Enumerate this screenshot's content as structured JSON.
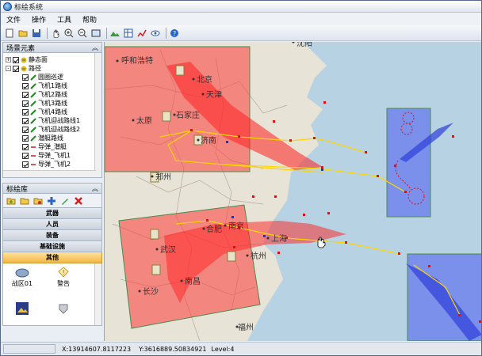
{
  "window": {
    "title": "标绘系统"
  },
  "menu": [
    "文件",
    "操作",
    "工具",
    "帮助"
  ],
  "toolbar_icons": [
    "new-file-icon",
    "open-folder-icon",
    "save-icon",
    "pan-icon",
    "zoom-in-icon",
    "zoom-out-icon",
    "full-extent-icon",
    "terrain-icon",
    "grid-icon",
    "line-chart-icon",
    "eye-icon",
    "help-icon"
  ],
  "scene_panel": {
    "title": "场景元素",
    "items": [
      {
        "label": "静态面",
        "level": 1,
        "checked": true,
        "expander": "+"
      },
      {
        "label": "路径",
        "level": 1,
        "checked": true,
        "expander": "-"
      },
      {
        "label": "圆圈巡逻",
        "level": 2,
        "checked": true
      },
      {
        "label": "飞机1路线",
        "level": 2,
        "checked": true
      },
      {
        "label": "飞机2路线",
        "level": 2,
        "checked": true
      },
      {
        "label": "飞机3路线",
        "level": 2,
        "checked": true
      },
      {
        "label": "飞机4路线",
        "level": 2,
        "checked": true
      },
      {
        "label": "飞机迎战路线1",
        "level": 2,
        "checked": true
      },
      {
        "label": "飞机迎战路线2",
        "level": 2,
        "checked": true
      },
      {
        "label": "潜艇路线",
        "level": 2,
        "checked": true
      },
      {
        "label": "导弹_潜艇",
        "level": 2,
        "checked": true
      },
      {
        "label": "导弹_飞机1",
        "level": 2,
        "checked": true
      },
      {
        "label": "导弹_飞机2",
        "level": 2,
        "checked": true
      }
    ]
  },
  "library_panel": {
    "title": "标绘库",
    "categories": [
      "武器",
      "人员",
      "装备",
      "基础设施",
      "其他"
    ],
    "active_category": "其他",
    "symbols": [
      {
        "label": "战区01",
        "icon": "ellipse-icon"
      },
      {
        "label": "警告",
        "icon": "warning-icon"
      },
      {
        "label": "",
        "icon": "image-icon"
      },
      {
        "label": "",
        "icon": "shield-icon"
      }
    ]
  },
  "map": {
    "cities": [
      "呼和浩特",
      "北京",
      "天津",
      "石家庄",
      "太原",
      "济南",
      "郑州",
      "合肥",
      "南京",
      "上海",
      "武汉",
      "杭州",
      "南昌",
      "长沙",
      "福州",
      "沈阳"
    ],
    "colors": {
      "red_zone": "#ff3b3b",
      "blue_zone": "#5b6cf0",
      "route": "#ffd400",
      "point": "#e01010"
    }
  },
  "status": {
    "x": "X:13914607.8117223",
    "y": "Y:3616889.50834921",
    "level": "Level:4"
  }
}
